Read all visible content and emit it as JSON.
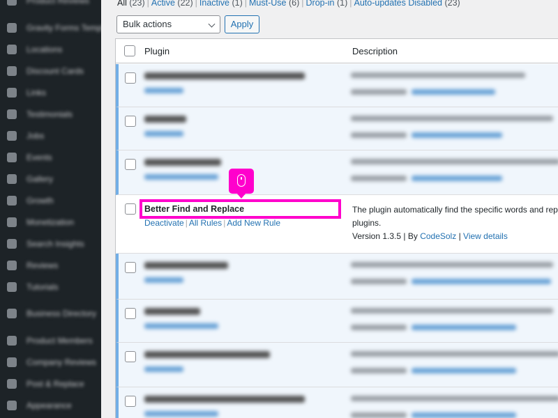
{
  "sidebar": {
    "items": [
      {
        "label": "Product Reviews"
      },
      {
        "label": "Gravity Forms Templates"
      },
      {
        "label": "Locations"
      },
      {
        "label": "Discount Cards"
      },
      {
        "label": "Links"
      },
      {
        "label": "Testimonials"
      },
      {
        "label": "Jobs"
      },
      {
        "label": "Events"
      },
      {
        "label": "Gallery"
      },
      {
        "label": "Growth"
      },
      {
        "label": "Monetization"
      },
      {
        "label": "Search Insights"
      },
      {
        "label": "Reviews"
      },
      {
        "label": "Tutorials"
      },
      {
        "label": "Business Directory"
      },
      {
        "label": "Product Members"
      },
      {
        "label": "Company Reviews"
      },
      {
        "label": "Post & Replace"
      },
      {
        "label": "Appearance"
      }
    ]
  },
  "filters": {
    "all": "All",
    "all_count": "(23)",
    "active": "Active",
    "active_count": "(22)",
    "inactive": "Inactive",
    "inactive_count": "(1)",
    "mustuse": "Must-Use",
    "mustuse_count": "(6)",
    "dropin": "Drop-in",
    "dropin_count": "(1)",
    "autoupdates": "Auto-updates Disabled",
    "autoupdates_count": "(23)",
    "separator": "|"
  },
  "bulk": {
    "selected": "Bulk actions",
    "apply": "Apply"
  },
  "table": {
    "col_plugin": "Plugin",
    "col_description": "Description"
  },
  "focus_plugin": {
    "name": "Better Find and Replace",
    "action_deactivate": "Deactivate",
    "action_all_rules": "All Rules",
    "action_add_rule": "Add New Rule",
    "description_line1": "The plugin automatically find the specific words and repla",
    "description_line2": "plugins.",
    "version_text": "Version 1.3.5 | By",
    "author": "CodeSolz",
    "view_details": "View details",
    "separator": "|"
  },
  "colors": {
    "highlight": "#ff00cc",
    "link": "#2271b1",
    "active_row_bg": "#f0f6fc",
    "active_border": "#72aee6",
    "sidebar_bg": "#1d2327"
  },
  "icons": {
    "cursor": "mouse-icon",
    "dropdown": "chevron-down-icon"
  }
}
